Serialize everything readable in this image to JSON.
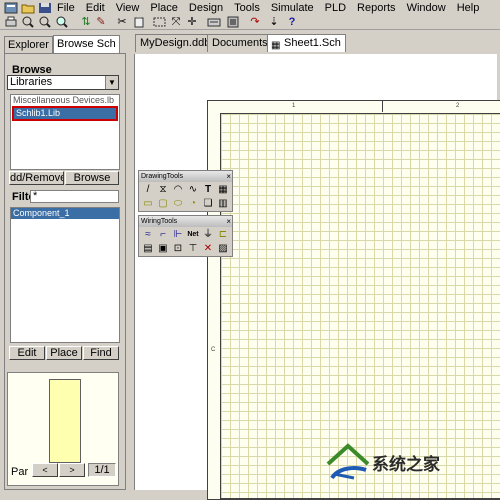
{
  "menu": {
    "items": [
      "File",
      "Edit",
      "View",
      "Place",
      "Design",
      "Tools",
      "Simulate",
      "PLD",
      "Reports",
      "Window",
      "Help"
    ]
  },
  "toolbar": {
    "icons": [
      "app-menu-icon",
      "open-folder-icon",
      "save-icon",
      "print-icon",
      "zoom-in-icon",
      "zoom-out-icon",
      "zoom-fit-icon",
      "arrows-icon",
      "wire-icon",
      "cut-icon",
      "paste-icon",
      "select-icon",
      "deselect-icon",
      "move-icon",
      "simulate-icon",
      "pld-icon",
      "filter-icon",
      "help-icon"
    ]
  },
  "left_panel": {
    "tabs": [
      "Explorer",
      "Browse Sch"
    ],
    "browse_group": "Browse",
    "browse_select_value": "Libraries",
    "libraries": [
      "Miscellaneous Devices.lb",
      "Schlib1.Lib"
    ],
    "selected_library": "Schlib1.Lib",
    "buttons": {
      "add_remove": "dd/Remove",
      "browse": "Browse"
    },
    "filter_label": "Filte",
    "filter_value": "*",
    "components": [
      "Component_1"
    ],
    "actions": {
      "edit": "Edit",
      "place": "Place",
      "find": "Find"
    },
    "part_label": "Par",
    "part_counter": "1/1"
  },
  "document_tabs": {
    "tabs": [
      "MyDesign.ddb",
      "Documents",
      "Sheet1.Sch"
    ],
    "active": "Sheet1.Sch"
  },
  "sheet": {
    "zone_labels": {
      "top_1": "1",
      "top_2": "2",
      "left_c": "C"
    }
  },
  "palettes": {
    "drawing_tools": {
      "title": "DrawingTools",
      "row1": [
        "/",
        "⧖",
        "◠",
        "∿",
        "T",
        "▦"
      ],
      "row2": [
        "▭",
        "▢",
        "⬭",
        "◔",
        "❏",
        "▥"
      ]
    },
    "wiring_tools": {
      "title": "WiringTools",
      "row1": [
        "≈",
        "⌐",
        "⊩",
        "Net",
        "⏚",
        "⊏"
      ],
      "row2": [
        "▤",
        "▣",
        "⊡",
        "⊤",
        "✕",
        "▨"
      ]
    },
    "close": "×"
  },
  "watermark": {
    "text": "系统之家"
  },
  "colors": {
    "chrome": "#d4d0c8",
    "selection": "#3a6ea5",
    "highlight_box": "#cc0000",
    "grid_line": "#d8d8a8",
    "sheet_bg": "#fffff0"
  }
}
